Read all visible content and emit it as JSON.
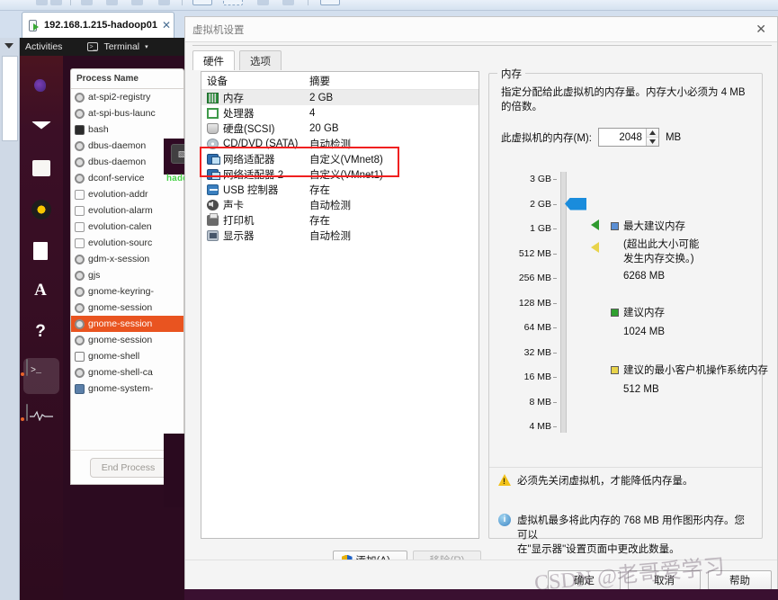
{
  "vmware": {
    "tab": {
      "title": "192.168.1.215-hadoop01",
      "close": "✕",
      "icon": "vm-power-icon"
    },
    "left_close": "✕"
  },
  "guest": {
    "topbar": {
      "activities": "Activities",
      "app_icon": "terminal-icon",
      "app": "Terminal",
      "caret": "▾"
    },
    "dock": [
      {
        "name": "firefox",
        "label": "Firefox"
      },
      {
        "name": "thunderbird",
        "label": "Thunderbird"
      },
      {
        "name": "files",
        "label": "Files"
      },
      {
        "name": "rhythmbox",
        "label": "Rhythmbox"
      },
      {
        "name": "libreoffice-writer",
        "label": "LibreOffice Writer"
      },
      {
        "name": "ubuntu-software",
        "label": "Ubuntu Software"
      },
      {
        "name": "help",
        "label": "Help"
      },
      {
        "name": "terminal",
        "label": "Terminal"
      },
      {
        "name": "system-monitor",
        "label": "System Monitor"
      }
    ],
    "sysmon": {
      "header": "Process Name",
      "processes": [
        {
          "name": "at-spi2-registry",
          "icon": "gear"
        },
        {
          "name": "at-spi-bus-launc",
          "icon": "gear"
        },
        {
          "name": "bash",
          "icon": "term"
        },
        {
          "name": "dbus-daemon",
          "icon": "gear"
        },
        {
          "name": "dbus-daemon",
          "icon": "gear"
        },
        {
          "name": "dconf-service",
          "icon": "gear"
        },
        {
          "name": "evolution-addr",
          "icon": "env"
        },
        {
          "name": "evolution-alarm",
          "icon": "env"
        },
        {
          "name": "evolution-calen",
          "icon": "env"
        },
        {
          "name": "evolution-sourc",
          "icon": "env"
        },
        {
          "name": "gdm-x-session",
          "icon": "gear"
        },
        {
          "name": "gjs",
          "icon": "gear"
        },
        {
          "name": "gnome-keyring-",
          "icon": "gear"
        },
        {
          "name": "gnome-session",
          "icon": "gear"
        },
        {
          "name": "gnome-session",
          "icon": "gear",
          "selected": true
        },
        {
          "name": "gnome-session",
          "icon": "gear"
        },
        {
          "name": "gnome-shell",
          "icon": "shell"
        },
        {
          "name": "gnome-shell-ca",
          "icon": "gear"
        },
        {
          "name": "gnome-system-",
          "icon": "mon"
        }
      ],
      "end_process": "End Process"
    },
    "terminal_text": "hadoo"
  },
  "dialog": {
    "title": "虚拟机设置",
    "close": "✕",
    "tabs": [
      {
        "label": "硬件",
        "active": true
      },
      {
        "label": "选项",
        "active": false
      }
    ],
    "device_list": {
      "headers": {
        "device": "设备",
        "summary": "摘要"
      },
      "rows": [
        {
          "device": "内存",
          "summary": "2 GB",
          "icon": "memory",
          "selected": true
        },
        {
          "device": "处理器",
          "summary": "4",
          "icon": "cpu"
        },
        {
          "device": "硬盘(SCSI)",
          "summary": "20 GB",
          "icon": "hdd"
        },
        {
          "device": "CD/DVD (SATA)",
          "summary": "自动检测",
          "icon": "cd"
        },
        {
          "device": "网络适配器",
          "summary": "自定义(VMnet8)",
          "icon": "net"
        },
        {
          "device": "网络适配器 2",
          "summary": "自定义(VMnet1)",
          "icon": "net"
        },
        {
          "device": "USB 控制器",
          "summary": "存在",
          "icon": "usb"
        },
        {
          "device": "声卡",
          "summary": "自动检测",
          "icon": "sound"
        },
        {
          "device": "打印机",
          "summary": "存在",
          "icon": "printer"
        },
        {
          "device": "显示器",
          "summary": "自动检测",
          "icon": "display"
        }
      ],
      "highlight_color": "#f02020"
    },
    "add_button": "添加(A)...",
    "remove_button": "移除(R)",
    "memory": {
      "legend": "内存",
      "description": "指定分配给此虚拟机的内存量。内存大小必须为 4 MB 的倍数。",
      "field_label": "此虚拟机的内存(M):",
      "value": "2048",
      "unit": "MB",
      "spin_up": "▲",
      "spin_down": "▼",
      "scale_labels": [
        "3 GB",
        "2 GB",
        "1 GB",
        "512 MB",
        "256 MB",
        "128 MB",
        "64 MB",
        "32 MB",
        "16 MB",
        "8 MB",
        "4 MB"
      ],
      "thumb_label": "2 GB",
      "legend_items": [
        {
          "key": "max_recommended",
          "color": "#5b8fd4",
          "title": "最大建议内存",
          "note": "(超出此大小可能\n发生内存交换。)",
          "value": "6268 MB"
        },
        {
          "key": "recommended",
          "color": "#2fa02f",
          "title": "建议内存",
          "value": "1024 MB"
        },
        {
          "key": "minimum_guest_os",
          "color": "#e8d34a",
          "title": "建议的最小客户机操作系统内存",
          "value": "512 MB"
        }
      ],
      "note_line1": "(超出此大小可能",
      "note_line2": "发生内存交换。)",
      "warning": "必须先关闭虚拟机，才能降低内存量。",
      "info_line1": "虚拟机最多将此内存的 768 MB 用作图形内存。您可以",
      "info_line2": "在\"显示器\"设置页面中更改此数量。",
      "info_symbol": "i"
    },
    "ok_button": "确定",
    "cancel_button": "取消",
    "help_button": "帮助"
  },
  "watermark": "CSDN @老哥爱学习"
}
